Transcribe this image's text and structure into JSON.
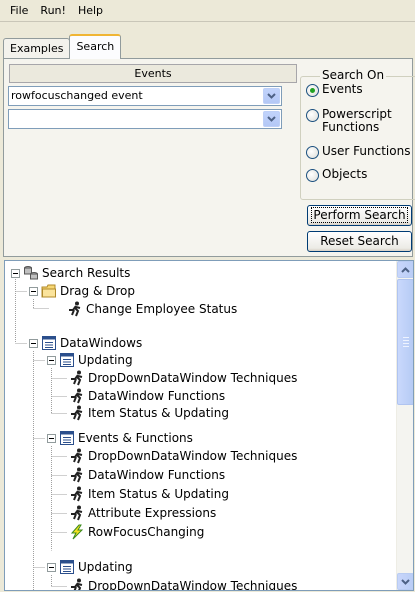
{
  "menu": {
    "items": [
      "File",
      "Run!",
      "Help"
    ]
  },
  "tabs": [
    {
      "label": "Examples",
      "active": false
    },
    {
      "label": "Search",
      "active": true
    }
  ],
  "search_panel": {
    "events_header": "Events",
    "event_combo_value": "rowfocuschanged event",
    "second_combo_value": "",
    "search_on_legend": "Search On",
    "search_on_options": [
      {
        "label": "Events",
        "checked": true
      },
      {
        "label": "Powerscript Functions",
        "checked": false
      },
      {
        "label": "User Functions",
        "checked": false
      },
      {
        "label": "Objects",
        "checked": false
      }
    ],
    "perform_search_label": "Perform Search",
    "reset_search_label": "Reset Search"
  },
  "tree": {
    "root": "Search Results",
    "drag_drop": {
      "label": "Drag & Drop",
      "items": [
        "Change Employee Status"
      ]
    },
    "datawindows": {
      "label": "DataWindows"
    },
    "updating_1": {
      "label": "Updating",
      "items": [
        "DropDownDataWindow Techniques",
        "DataWindow Functions",
        "Item Status & Updating"
      ]
    },
    "events_functions": {
      "label": "Events & Functions",
      "items": [
        "DropDownDataWindow Techniques",
        "DataWindow Functions",
        "Item Status & Updating",
        "Attribute Expressions",
        "RowFocusChanging"
      ]
    },
    "updating_2": {
      "label": "Updating",
      "items": [
        "DropDownDataWindow Techniques"
      ]
    }
  },
  "icons": {
    "run": "running-man-icon",
    "event": "lightning-icon",
    "folder": "folder-icon",
    "list": "list-window-icon",
    "db": "database-icon"
  }
}
